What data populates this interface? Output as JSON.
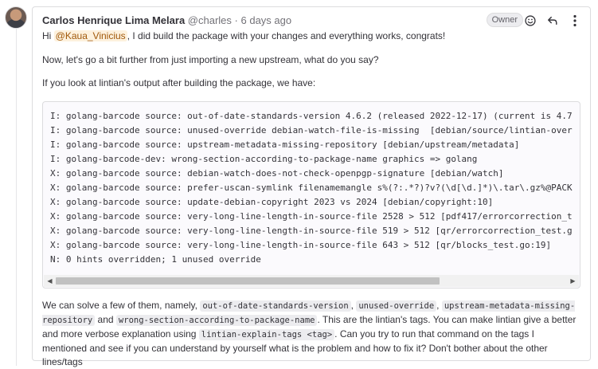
{
  "comment": {
    "author_name": "Carlos Henrique Lima Melara",
    "author_username": "@charles",
    "separator": "·",
    "timestamp": "6 days ago",
    "role_badge": "Owner",
    "actions": {
      "emoji_icon": "smile-icon",
      "reply_icon": "reply-icon",
      "more_icon": "kebab-menu-icon"
    },
    "p1": {
      "prefix": "Hi ",
      "mention": "@Kaua_Vinicius",
      "suffix": ", I did build the package with your changes and everything works, congrats!"
    },
    "p2": "Now, let's go a bit further from just importing a new upstream, what do you say?",
    "p3": "If you look at lintian's output after building the package, we have:",
    "code_lines": [
      "I: golang-barcode source: out-of-date-standards-version 4.6.2 (released 2022-12-17) (current is 4.7",
      "I: golang-barcode source: unused-override debian-watch-file-is-missing  [debian/source/lintian-over",
      "I: golang-barcode source: upstream-metadata-missing-repository [debian/upstream/metadata]",
      "I: golang-barcode-dev: wrong-section-according-to-package-name graphics => golang",
      "X: golang-barcode source: debian-watch-does-not-check-openpgp-signature [debian/watch]",
      "X: golang-barcode source: prefer-uscan-symlink filenamemangle s%(?:.*?)?v?(\\d[\\d.]*)\\.tar\\.gz%@PACK",
      "X: golang-barcode source: update-debian-copyright 2023 vs 2024 [debian/copyright:10]",
      "X: golang-barcode source: very-long-line-length-in-source-file 2528 > 512 [pdf417/errorcorrection_t",
      "X: golang-barcode source: very-long-line-length-in-source-file 519 > 512 [qr/errorcorrection_test.g",
      "X: golang-barcode source: very-long-line-length-in-source-file 643 > 512 [qr/blocks_test.go:19]",
      "N: 0 hints overridden; 1 unused override"
    ],
    "p4": {
      "t1": "We can solve a few of them, namely, ",
      "c1": "out-of-date-standards-version",
      "t2": ", ",
      "c2": "unused-override",
      "t3": ", ",
      "c3": "upstream-metadata-missing-repository",
      "t4": " and ",
      "c4": "wrong-section-according-to-package-name",
      "t5": ". This are the lintian's tags. You can make lintian give a better and more verbose explanation using ",
      "c5": "lintian-explain-tags <tag>",
      "t6": ". Can you try to run that command on the tags I mentioned and see if you can understand by yourself what is the problem and how to fix it? Don't bother about the other lines/tags"
    }
  }
}
